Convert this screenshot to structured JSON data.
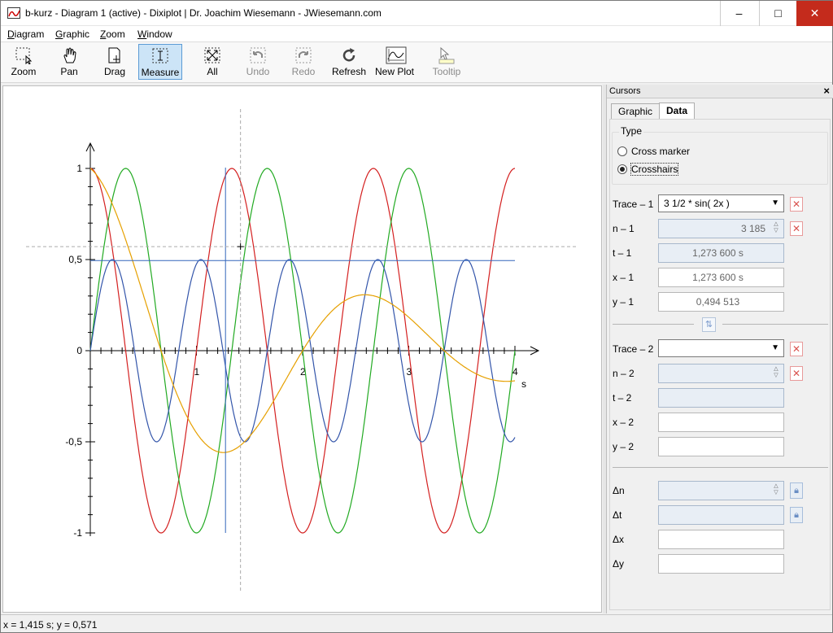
{
  "window": {
    "title": "b-kurz - Diagram 1 (active) - Dixiplot | Dr. Joachim Wiesemann - JWiesemann.com",
    "controls": [
      "–",
      "□",
      "✕"
    ]
  },
  "menu": [
    {
      "label": "Diagram",
      "accel": "D",
      "rest": "iagram"
    },
    {
      "label": "Graphic",
      "accel": "G",
      "rest": "raphic"
    },
    {
      "label": "Zoom",
      "accel": "Z",
      "rest": "oom"
    },
    {
      "label": "Window",
      "accel": "W",
      "rest": "indow"
    }
  ],
  "toolbar": {
    "zoom": "Zoom",
    "pan": "Pan",
    "drag": "Drag",
    "measure": "Measure",
    "all": "All",
    "undo": "Undo",
    "redo": "Redo",
    "refresh": "Refresh",
    "new_plot": "New Plot",
    "tooltip": "Tooltip"
  },
  "panel": {
    "title": "Cursors",
    "tabs": {
      "graphic": "Graphic",
      "data": "Data"
    },
    "type_group": {
      "title": "Type",
      "options": [
        "Cross marker",
        "Crosshairs"
      ],
      "selected": "Crosshairs"
    },
    "trace1": {
      "label": "Trace – 1",
      "value": "3 1/2 * sin( 2x )",
      "n_label": "n – 1",
      "n_value": "3 185",
      "t_label": "t – 1",
      "t_value": "1,273 600 s",
      "x_label": "x – 1",
      "x_value": "1,273 600 s",
      "y_label": "y – 1",
      "y_value": "0,494 513"
    },
    "trace2": {
      "label": "Trace – 2",
      "value": "",
      "n_label": "n – 2",
      "n_value": "",
      "t_label": "t – 2",
      "t_value": "",
      "x_label": "x – 2",
      "x_value": "",
      "y_label": "y – 2",
      "y_value": ""
    },
    "delta": {
      "dn_label": "Δn",
      "dn_value": "",
      "dt_label": "Δt",
      "dt_value": "",
      "dx_label": "Δx",
      "dx_value": "",
      "dy_label": "Δy",
      "dy_value": ""
    }
  },
  "status": {
    "text": "x = 1,415 s; y = 0,571"
  },
  "chart_data": {
    "type": "line",
    "x_unit": "s",
    "xlim": [
      0,
      4
    ],
    "ylim": [
      -1,
      1
    ],
    "x_tick_labels": [
      "1",
      "2",
      "3",
      "4"
    ],
    "y_tick_labels": [
      "1",
      "0,5",
      "0",
      "-0,5",
      "-1"
    ],
    "y_tick_values": [
      1,
      0.5,
      0,
      -0.5,
      -1
    ],
    "series": [
      {
        "color": "#d42020",
        "formula": "cos(3x)"
      },
      {
        "color": "#22aa22",
        "formula": "cos(3x - 1.5)"
      },
      {
        "color": "#3355aa",
        "formula": "0.5*|sin(2.4x)| style"
      },
      {
        "color": "#e6a000",
        "formula": "damped cosine"
      }
    ],
    "cursor1": {
      "x": 1.2736,
      "y": 0.494513
    },
    "mouse": {
      "x": 1.415,
      "y": 0.571
    }
  }
}
